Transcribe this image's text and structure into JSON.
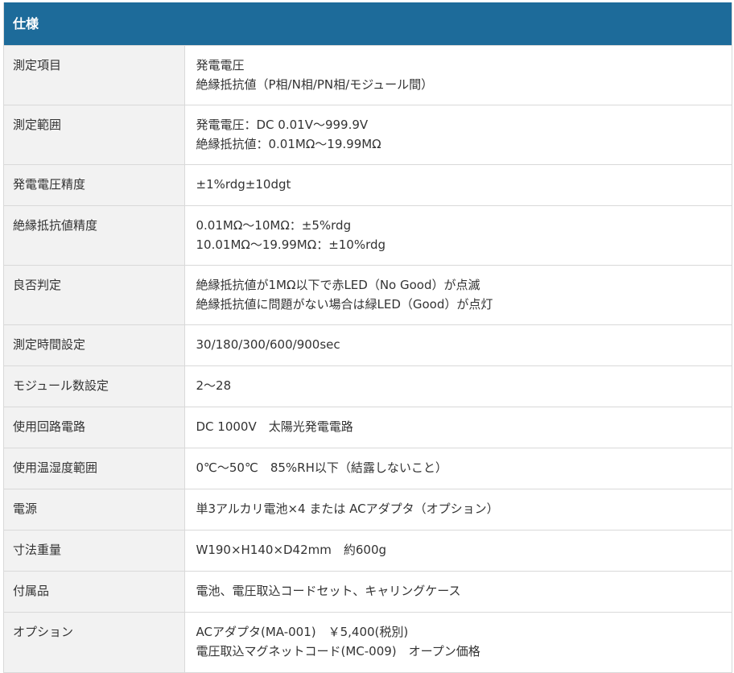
{
  "header": {
    "title": "仕様"
  },
  "rows": [
    {
      "label": "測定項目",
      "lines": [
        "発電電圧",
        "絶縁抵抗値（P相/N相/PN相/モジュール間）"
      ]
    },
    {
      "label": "測定範囲",
      "lines": [
        "発電電圧：DC 0.01V〜999.9V",
        "絶縁抵抗値：0.01MΩ〜19.99MΩ"
      ]
    },
    {
      "label": "発電電圧精度",
      "lines": [
        "±1%rdg±10dgt"
      ]
    },
    {
      "label": "絶縁抵抗値精度",
      "lines": [
        "0.01MΩ〜10MΩ：±5%rdg",
        "10.01MΩ〜19.99MΩ：±10%rdg"
      ]
    },
    {
      "label": "良否判定",
      "lines": [
        "絶縁抵抗値が1MΩ以下で赤LED（No Good）が点滅",
        "絶縁抵抗値に問題がない場合は緑LED（Good）が点灯"
      ]
    },
    {
      "label": "測定時間設定",
      "lines": [
        "30/180/300/600/900sec"
      ]
    },
    {
      "label": "モジュール数設定",
      "lines": [
        "2〜28"
      ]
    },
    {
      "label": "使用回路電路",
      "lines": [
        "DC 1000V　太陽光発電電路"
      ]
    },
    {
      "label": "使用温湿度範囲",
      "lines": [
        "0℃〜50℃　85%RH以下（結露しないこと）"
      ]
    },
    {
      "label": "電源",
      "lines": [
        "単3アルカリ電池×4 または ACアダプタ（オプション）"
      ]
    },
    {
      "label": "寸法重量",
      "lines": [
        "W190×H140×D42mm　約600g"
      ]
    },
    {
      "label": "付属品",
      "lines": [
        "電池、電圧取込コードセット、キャリングケース"
      ]
    },
    {
      "label": "オプション",
      "lines": [
        "ACアダプタ(MA-001)　￥5,400(税別)",
        "電圧取込マグネットコード(MC-009)　オープン価格"
      ]
    }
  ]
}
